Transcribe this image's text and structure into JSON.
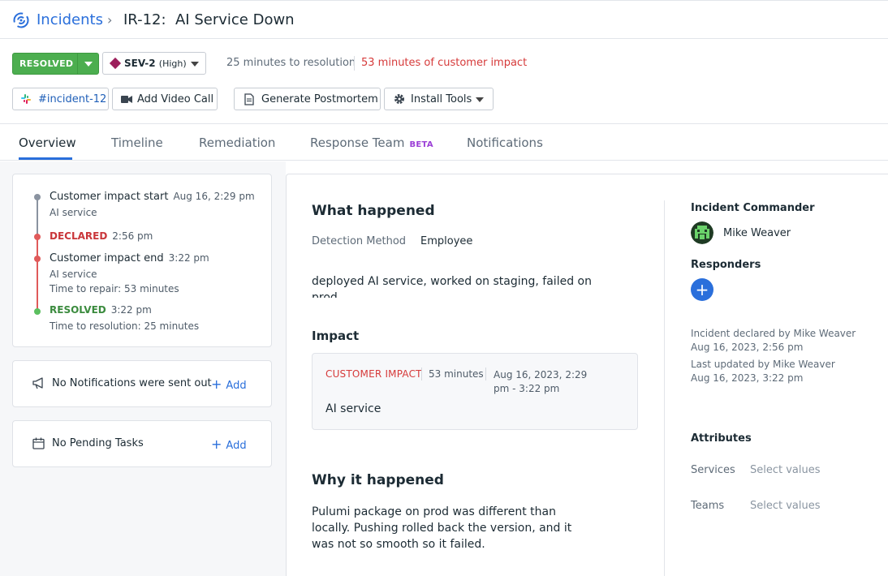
{
  "header": {
    "breadcrumb_root": "Incidents",
    "title": "IR-12:  AI Service Down"
  },
  "status_bar": {
    "status": "RESOLVED",
    "severity": "SEV-2",
    "severity_detail": "(High)",
    "resolution_time": "25 minutes to resolution",
    "customer_impact": "53 minutes of customer impact"
  },
  "actions": {
    "slack_channel": "#incident-12",
    "video_call": "Add Video Call",
    "postmortem": "Generate Postmortem",
    "install_tools": "Install Tools"
  },
  "tabs": [
    {
      "label": "Overview"
    },
    {
      "label": "Timeline"
    },
    {
      "label": "Remediation"
    },
    {
      "label": "Response Team",
      "badge": "BETA"
    },
    {
      "label": "Notifications"
    }
  ],
  "timeline": {
    "events": [
      {
        "title": "Customer impact start",
        "time": "Aug 16, 2:29 pm",
        "sub": [
          "AI service"
        ]
      },
      {
        "title": "DECLARED",
        "time": "2:56 pm",
        "sub": []
      },
      {
        "title": "Customer impact end",
        "time": "3:22 pm",
        "sub": [
          "AI service",
          "Time to repair: 53 minutes"
        ]
      },
      {
        "title": "RESOLVED",
        "time": "3:22 pm",
        "sub": [
          "Time to resolution: 25 minutes"
        ]
      }
    ]
  },
  "notifications_card": {
    "label": "No Notifications were sent out",
    "add": "Add"
  },
  "tasks_card": {
    "label": "No Pending Tasks",
    "add": "Add"
  },
  "what_happened": {
    "heading": "What happened",
    "detection_label": "Detection Method",
    "detection_value": "Employee",
    "description": "deployed AI service, worked on staging, failed on prod"
  },
  "impact": {
    "heading": "Impact",
    "label": "CUSTOMER IMPACT",
    "duration": "53 minutes",
    "range": "Aug 16, 2023, 2:29 pm - 3:22 pm",
    "service": "AI service"
  },
  "why_happened": {
    "heading": "Why it happened",
    "text": "Pulumi package on prod was different than locally. Pushing rolled back the version, and it was not so smooth so it failed."
  },
  "sidebar": {
    "commander_heading": "Incident Commander",
    "commander_name": "Mike Weaver",
    "responders_heading": "Responders",
    "declared_by": "Incident declared by Mike Weaver",
    "declared_at": "Aug 16, 2023, 2:56 pm",
    "updated_by": "Last updated by Mike Weaver",
    "updated_at": "Aug 16, 2023, 3:22 pm",
    "attributes_heading": "Attributes",
    "attributes": [
      {
        "key": "Services",
        "value": "Select values"
      },
      {
        "key": "Teams",
        "value": "Select values"
      }
    ]
  },
  "colors": {
    "accent": "#2a6fdb",
    "resolved_green": "#4cae4f",
    "sev_diamond": "#9c1f5c",
    "impact_red": "#d63a3a"
  },
  "icons": [
    "incidents-icon",
    "chevron-right-icon",
    "slack-icon",
    "video-camera-icon",
    "document-icon",
    "gear-icon",
    "megaphone-icon",
    "calendar-icon",
    "plus-icon",
    "avatar-icon"
  ]
}
